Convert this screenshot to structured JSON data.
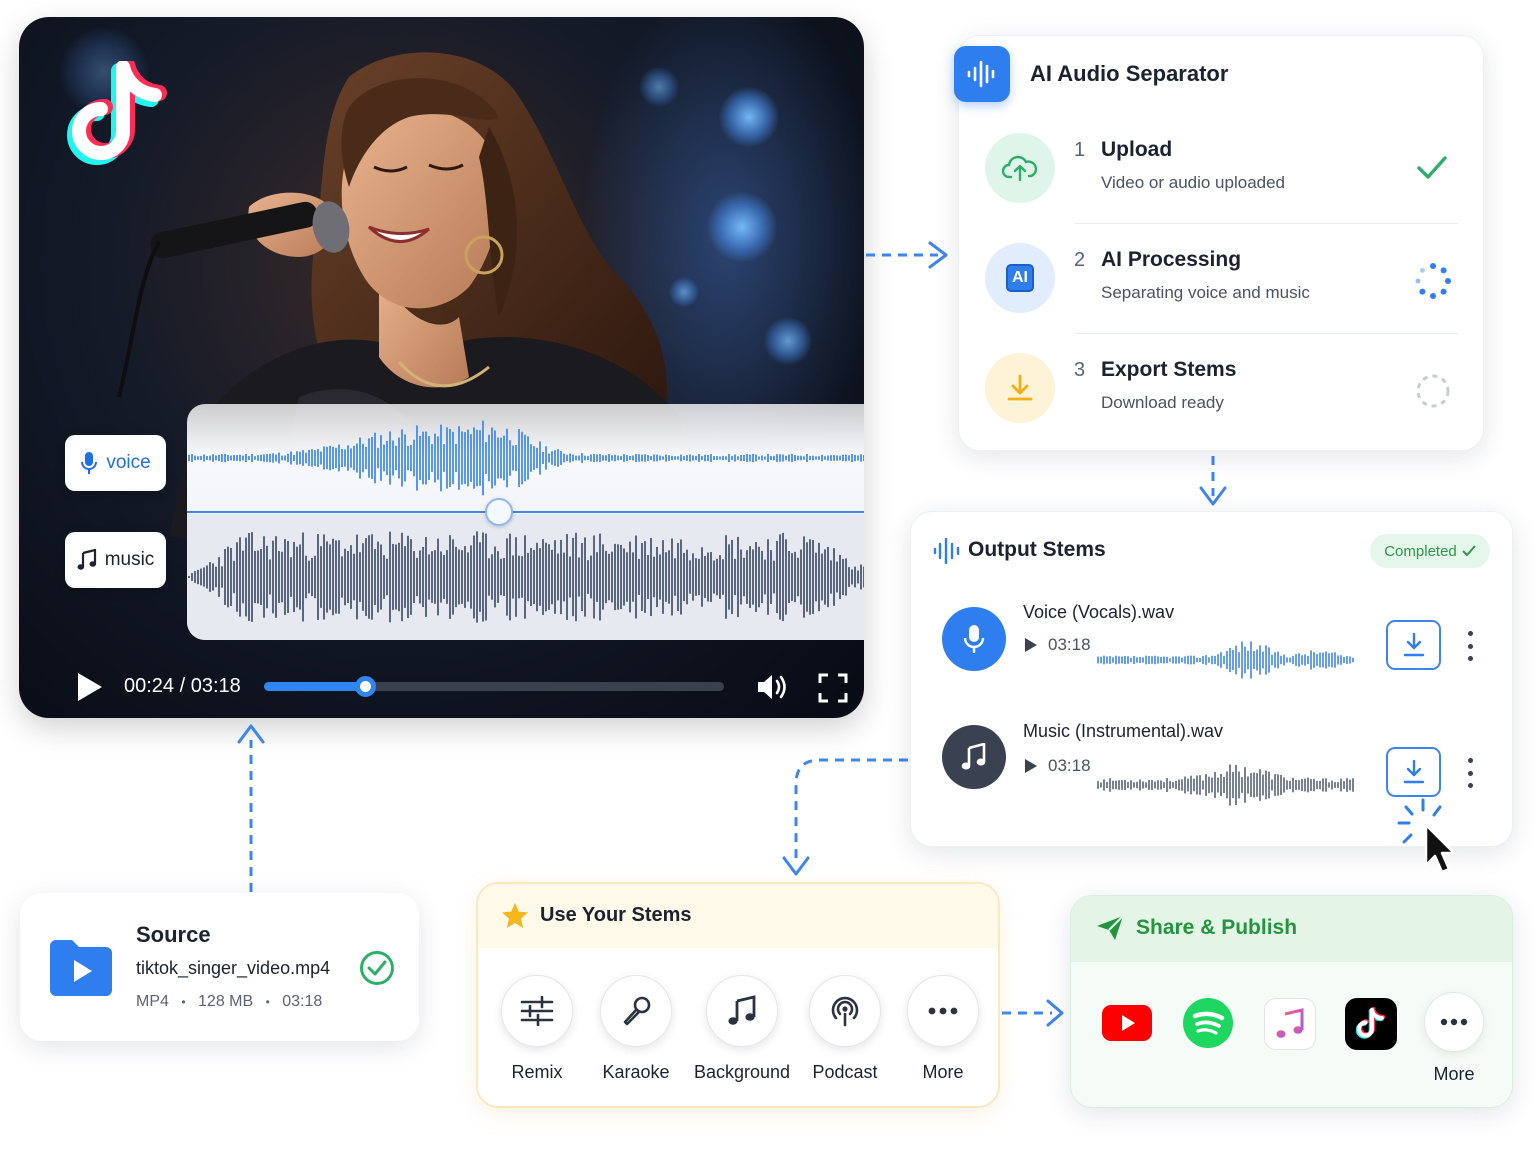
{
  "player": {
    "current_time": "00:24",
    "duration": "03:18",
    "time_separator": " / ",
    "progress_fraction": 0.22,
    "track_labels": {
      "voice": "voice",
      "music": "music"
    }
  },
  "separator": {
    "title": "AI Audio Separator",
    "steps": [
      {
        "number": "1",
        "name": "Upload",
        "description": "Video or audio uploaded",
        "status": "done"
      },
      {
        "number": "2",
        "name": "AI Processing",
        "description": "Separating voice and music",
        "status": "in-progress"
      },
      {
        "number": "3",
        "name": "Export Stems",
        "description": "Download ready",
        "status": "pending"
      }
    ],
    "ai_badge_text": "AI"
  },
  "output": {
    "title": "Output Stems",
    "badge": "Completed",
    "stems": [
      {
        "name": "Voice (Vocals).wav",
        "duration": "03:18"
      },
      {
        "name": "Music (Instrumental).wav",
        "duration": "03:18"
      }
    ]
  },
  "source": {
    "title": "Source",
    "filename": "tiktok_singer_video.mp4",
    "format": "MP4",
    "size": "128 MB",
    "duration": "03:18",
    "meta_separator": "•"
  },
  "use_stems": {
    "title": "Use Your Stems",
    "tools": [
      {
        "label": "Remix",
        "icon": "sliders-icon"
      },
      {
        "label": "Karaoke",
        "icon": "microphone-icon"
      },
      {
        "label": "Background",
        "icon": "music-note-icon"
      },
      {
        "label": "Podcast",
        "icon": "podcast-icon"
      },
      {
        "label": "More",
        "icon": "more-icon"
      }
    ]
  },
  "share": {
    "title": "Share & Publish",
    "platforms": [
      "youtube-icon",
      "spotify-icon",
      "apple-music-icon",
      "tiktok-icon",
      "more-icon"
    ],
    "more_label": "More"
  },
  "colors": {
    "accent_blue": "#2f7ef0",
    "success_green": "#2c9a48",
    "dark_stem": "#3a4150",
    "warning_yellow": "#f5b71c"
  }
}
